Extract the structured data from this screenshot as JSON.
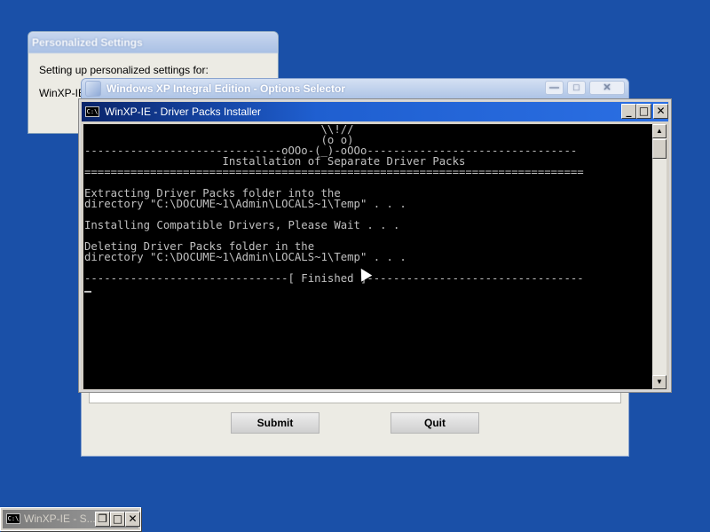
{
  "personalized_settings": {
    "title": "Personalized Settings",
    "line1": "Setting up personalized settings for:",
    "line2": "WinXP-IE"
  },
  "options_selector": {
    "title": "Windows XP Integral Edition - Options Selector",
    "submit_label": "Submit",
    "quit_label": "Quit",
    "minimize_glyph": "—",
    "maximize_glyph": "□",
    "close_glyph": "✕"
  },
  "console_window": {
    "icon_text": "C:\\",
    "title": "WinXP-IE - Driver Packs Installer",
    "minimize_glyph": "_",
    "maximize_glyph": "□",
    "close_glyph": "✕",
    "scroll_up_glyph": "▲",
    "scroll_down_glyph": "▼",
    "output": "                                    \\\\!//\n                                    (o o)\n------------------------------oOOo-(_)-oOOo--------------------------------\n                     Installation of Separate Driver Packs\n============================================================================\n\nExtracting Driver Packs folder into the\ndirectory \"C:\\DOCUME~1\\Admin\\LOCALS~1\\Temp\" . . .\n\nInstalling Compatible Drivers, Please Wait . . .\n\nDeleting Driver Packs folder in the\ndirectory \"C:\\DOCUME~1\\Admin\\LOCALS~1\\Temp\" . . .\n\n-------------------------------[ Finished ]---------------------------------"
  },
  "minimized_window": {
    "icon_text": "C:\\",
    "title": "WinXP-IE - S...",
    "restore_glyph": "❐",
    "maximize_glyph": "□",
    "close_glyph": "✕"
  }
}
